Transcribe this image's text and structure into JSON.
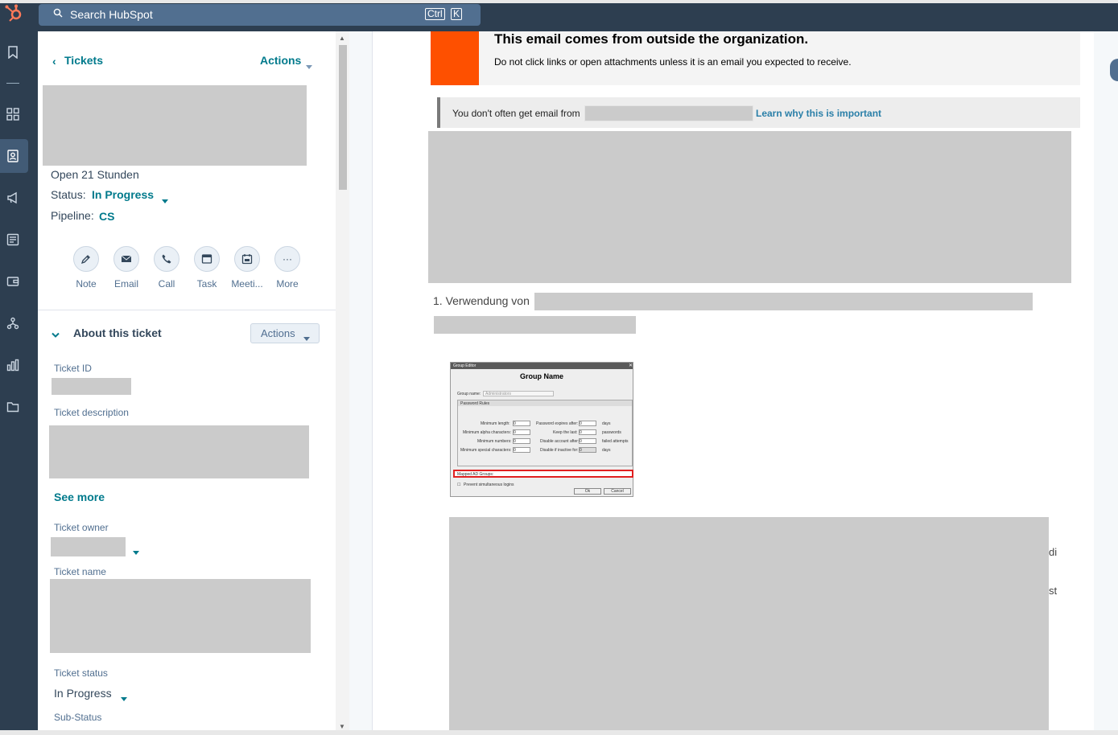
{
  "app": {
    "search_placeholder": "Search HubSpot",
    "kbd_ctrl": "Ctrl",
    "kbd_k": "K"
  },
  "sidebar": {
    "back_label": "Tickets",
    "actions_label": "Actions",
    "open_time": "Open 21 Stunden",
    "status_label": "Status:",
    "status_value": "In Progress",
    "pipeline_label": "Pipeline:",
    "pipeline_value": "CS",
    "activity_actions": [
      {
        "label": "Note",
        "icon": "note-icon"
      },
      {
        "label": "Email",
        "icon": "email-icon"
      },
      {
        "label": "Call",
        "icon": "call-icon"
      },
      {
        "label": "Task",
        "icon": "task-icon"
      },
      {
        "label": "Meeti...",
        "icon": "meeting-icon"
      },
      {
        "label": "More",
        "icon": "more-icon"
      }
    ],
    "about": {
      "title": "About this ticket",
      "actions_label": "Actions",
      "ticket_id_label": "Ticket ID",
      "ticket_description_label": "Ticket description",
      "see_more": "See more",
      "ticket_owner_label": "Ticket owner",
      "ticket_name_label": "Ticket name",
      "ticket_status_label": "Ticket status",
      "ticket_status_value": "In Progress",
      "sub_status_label": "Sub-Status"
    }
  },
  "email": {
    "warning_title": "This email comes from outside the organization.",
    "warning_body": "Do not click links or open attachments unless it is an email you expected to receive.",
    "info_text": "You don't often get email from",
    "info_link": "Learn why this is important",
    "list_item": "1. Verwendung von",
    "trailing_fragment_1": "di",
    "trailing_fragment_2": "st"
  },
  "dialog": {
    "window_title": "Group Editor",
    "heading": "Group Name",
    "group_name_label": "Group name:",
    "group_name_value": "Administrators",
    "section_label": "Password Rules",
    "rows": [
      {
        "left": "Minimum length:",
        "lval": "0",
        "right": "Password expires after:",
        "rval": "0",
        "unit": "days"
      },
      {
        "left": "Minimum alpha characters:",
        "lval": "0",
        "right": "Keep the last:",
        "rval": "0",
        "unit": "passwords"
      },
      {
        "left": "Minimum numbers:",
        "lval": "0",
        "right": "Disable account after:",
        "rval": "0",
        "unit": "failed attempts"
      },
      {
        "left": "Minimum special characters:",
        "lval": "0",
        "right": "Disable if inactive for:",
        "rval": "0",
        "unit": "days"
      }
    ],
    "mapped_label": "Mapped AD Groups:",
    "prevent_label": "Prevent simultaneous logins",
    "ok": "Ok",
    "cancel": "Cancel"
  },
  "colors": {
    "rail": "#2d3e50",
    "link": "#007a8c",
    "warning_orange": "#fe5000",
    "redaction": "#cbcbcb"
  }
}
